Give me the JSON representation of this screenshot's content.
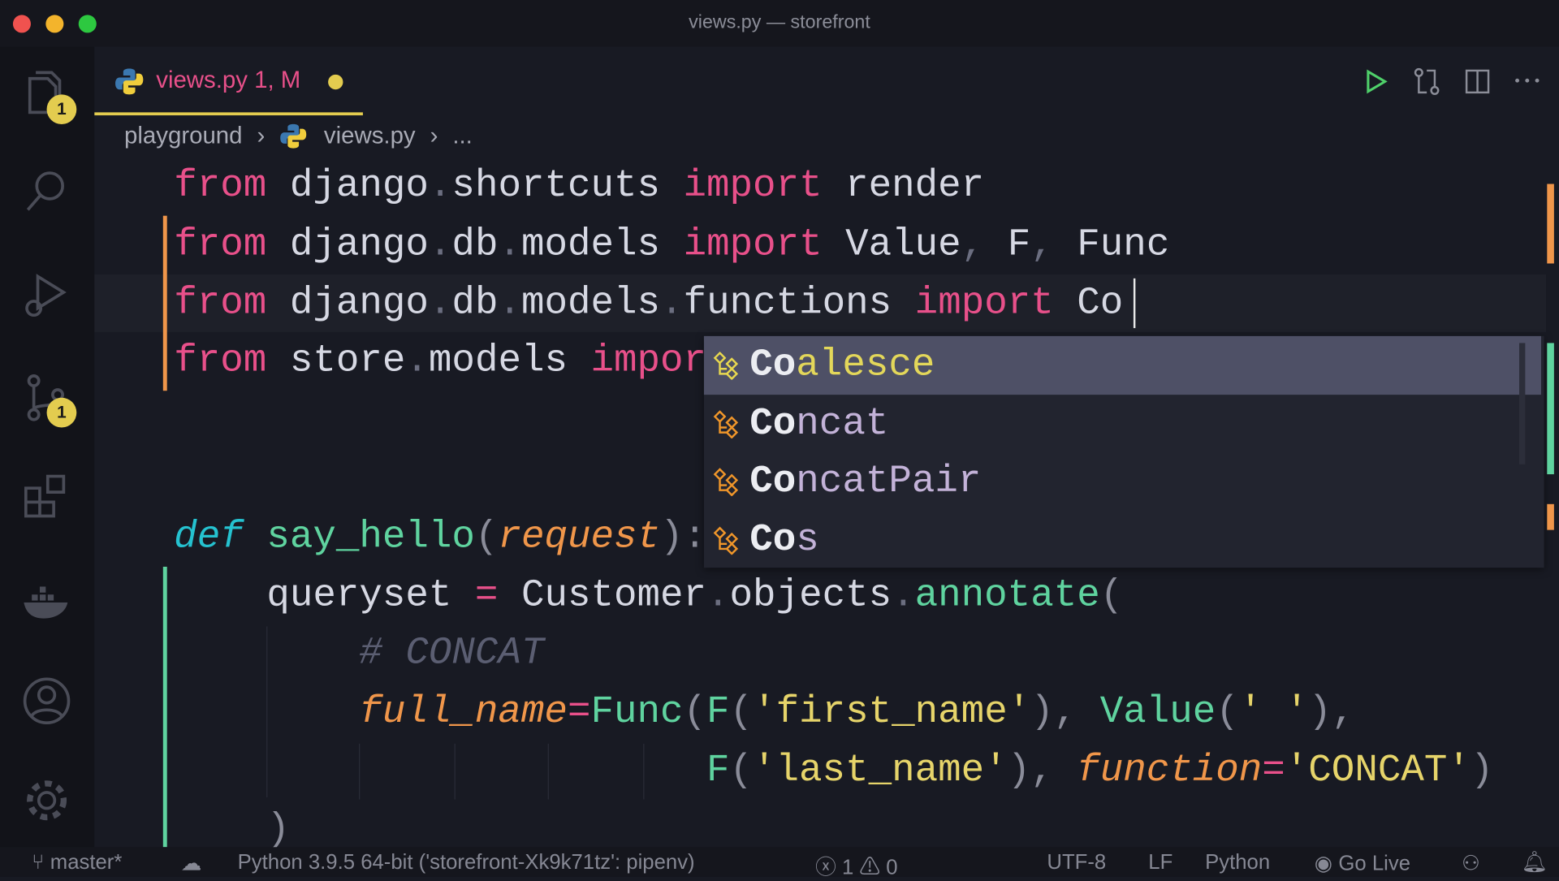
{
  "window": {
    "title": "views.py — storefront"
  },
  "activity_bar": {
    "explorer_badge": "1",
    "scm_badge": "1"
  },
  "tab": {
    "label": "views.py",
    "status": "1, M"
  },
  "breadcrumb": {
    "folder": "playground",
    "file": "views.py",
    "more": "..."
  },
  "code_lines": [
    [
      {
        "t": "from ",
        "c": "kw"
      },
      {
        "t": "django",
        "c": "tx"
      },
      {
        "t": ".",
        "c": "dt"
      },
      {
        "t": "shortcuts ",
        "c": "tx"
      },
      {
        "t": "import ",
        "c": "kw"
      },
      {
        "t": "render",
        "c": "tx"
      }
    ],
    [
      {
        "t": "from ",
        "c": "kw"
      },
      {
        "t": "django",
        "c": "tx"
      },
      {
        "t": ".",
        "c": "dt"
      },
      {
        "t": "db",
        "c": "tx"
      },
      {
        "t": ".",
        "c": "dt"
      },
      {
        "t": "models ",
        "c": "tx"
      },
      {
        "t": "import ",
        "c": "kw"
      },
      {
        "t": "Value",
        "c": "tx"
      },
      {
        "t": ", ",
        "c": "dt"
      },
      {
        "t": "F",
        "c": "tx"
      },
      {
        "t": ", ",
        "c": "dt"
      },
      {
        "t": "Func",
        "c": "tx"
      }
    ],
    [
      {
        "t": "from ",
        "c": "kw"
      },
      {
        "t": "django",
        "c": "tx"
      },
      {
        "t": ".",
        "c": "dt"
      },
      {
        "t": "db",
        "c": "tx"
      },
      {
        "t": ".",
        "c": "dt"
      },
      {
        "t": "models",
        "c": "tx"
      },
      {
        "t": ".",
        "c": "dt"
      },
      {
        "t": "functions ",
        "c": "tx"
      },
      {
        "t": "import ",
        "c": "kw"
      },
      {
        "t": "Co",
        "c": "tx"
      }
    ],
    [
      {
        "t": "from ",
        "c": "kw"
      },
      {
        "t": "store",
        "c": "tx"
      },
      {
        "t": ".",
        "c": "dt"
      },
      {
        "t": "models ",
        "c": "tx"
      },
      {
        "t": "import",
        "c": "kw"
      }
    ],
    [],
    [],
    [
      {
        "t": "def ",
        "c": "df"
      },
      {
        "t": "say_hello",
        "c": "fn"
      },
      {
        "t": "(",
        "c": "pr"
      },
      {
        "t": "request",
        "c": "pa"
      },
      {
        "t": "):",
        "c": "pr"
      }
    ],
    [
      {
        "t": "    queryset ",
        "c": "tx"
      },
      {
        "t": "= ",
        "c": "kw"
      },
      {
        "t": "Customer",
        "c": "tx"
      },
      {
        "t": ".",
        "c": "dt"
      },
      {
        "t": "objects",
        "c": "tx"
      },
      {
        "t": ".",
        "c": "dt"
      },
      {
        "t": "annotate",
        "c": "fn"
      },
      {
        "t": "(",
        "c": "pr"
      }
    ],
    [
      {
        "t": "        # CONCAT",
        "c": "cm"
      }
    ],
    [
      {
        "t": "        ",
        "c": "tx"
      },
      {
        "t": "full_name",
        "c": "pa"
      },
      {
        "t": "=",
        "c": "kw"
      },
      {
        "t": "Func",
        "c": "fn"
      },
      {
        "t": "(",
        "c": "pr"
      },
      {
        "t": "F",
        "c": "fn"
      },
      {
        "t": "(",
        "c": "pr"
      },
      {
        "t": "'first_name'",
        "c": "st"
      },
      {
        "t": "), ",
        "c": "pr"
      },
      {
        "t": "Value",
        "c": "fn"
      },
      {
        "t": "(",
        "c": "pr"
      },
      {
        "t": "' '",
        "c": "st"
      },
      {
        "t": "),",
        "c": "pr"
      }
    ],
    [
      {
        "t": "                       ",
        "c": "tx"
      },
      {
        "t": "F",
        "c": "fn"
      },
      {
        "t": "(",
        "c": "pr"
      },
      {
        "t": "'last_name'",
        "c": "st"
      },
      {
        "t": "), ",
        "c": "pr"
      },
      {
        "t": "function",
        "c": "pa"
      },
      {
        "t": "=",
        "c": "kw"
      },
      {
        "t": "'CONCAT'",
        "c": "st"
      },
      {
        "t": ")",
        "c": "pr"
      }
    ],
    [
      {
        "t": "    )",
        "c": "pr"
      }
    ]
  ],
  "suggestions": [
    {
      "match": "Co",
      "rest": "alesce",
      "selected": true
    },
    {
      "match": "Co",
      "rest": "ncat",
      "selected": false
    },
    {
      "match": "Co",
      "rest": "ncatPair",
      "selected": false
    },
    {
      "match": "Co",
      "rest": "s",
      "selected": false
    }
  ],
  "status_bar": {
    "branch": "master*",
    "interpreter": "Python 3.9.5 64-bit ('storefront-Xk9k71tz': pipenv)",
    "errors": "1",
    "warnings": "0",
    "encoding": "UTF-8",
    "eol": "LF",
    "language": "Python",
    "go_live": "Go Live"
  },
  "colors": {
    "kw": "#e8508a",
    "tx": "#d6d8e3",
    "dt": "#6b6e80",
    "df": "#25c2d0",
    "fn": "#5fd39f",
    "pa": "#f0964a",
    "st": "#e6d46a",
    "cm": "#5b5e72",
    "pr": "#8a8c99"
  }
}
